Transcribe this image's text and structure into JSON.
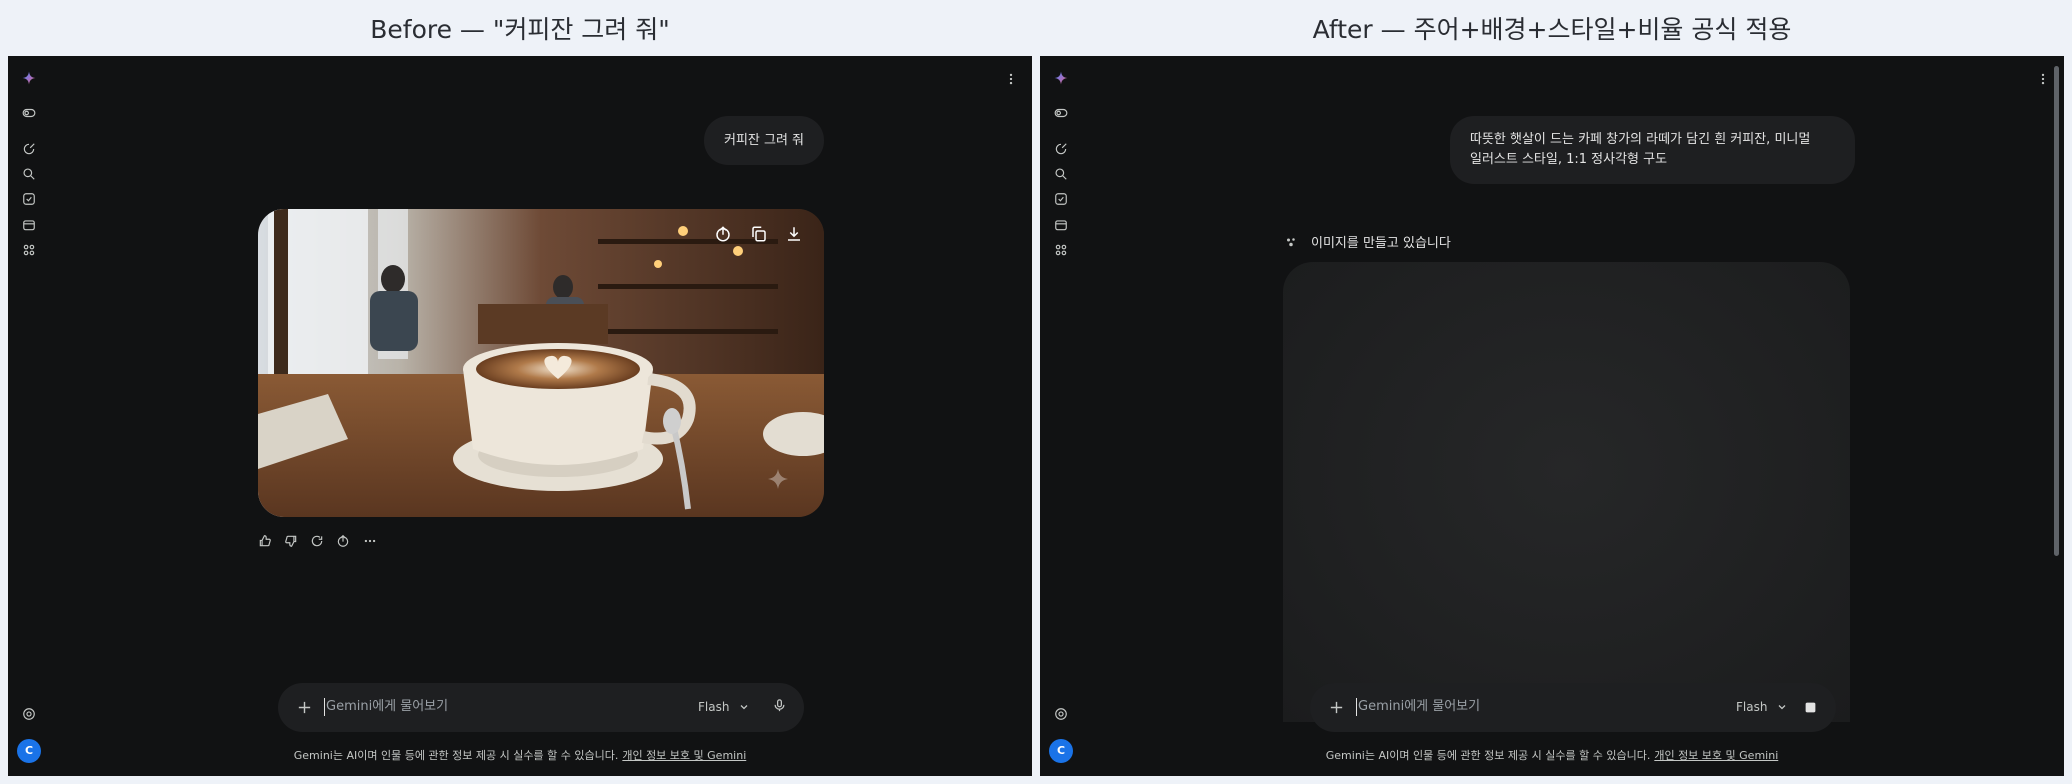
{
  "before": {
    "heading": "Before — \"커피잔 그려 줘\"",
    "user_prompt": "커피잔 그려 줘",
    "composer": {
      "placeholder": "Gemini에게 물어보기",
      "model": "Flash"
    },
    "disclaimer": {
      "text": "Gemini는 AI이며 인물 등에 관한 정보 제공 시 실수를 할 수 있습니다.",
      "link": "개인 정보 보호 및 Gemini"
    },
    "avatar_initial": "C"
  },
  "after": {
    "heading": "After — 주어+배경+스타일+비율 공식 적용",
    "user_prompt_line1": "따뜻한 햇살이 드는 카페 창가의 라떼가 담긴 흰 커피잔, 미니멀",
    "user_prompt_line2": "일러스트 스타일, 1:1 정사각형 구도",
    "status": "이미지를 만들고 있습니다",
    "composer": {
      "placeholder": "Gemini에게 물어보기",
      "model": "Flash"
    },
    "disclaimer": {
      "text": "Gemini는 AI이며 인물 등에 관한 정보 제공 시 실수를 할 수 있습니다.",
      "link": "개인 정보 보호 및 Gemini"
    },
    "avatar_initial": "C"
  },
  "colors": {
    "page_bg": "#eef2f8",
    "window_bg": "#111213",
    "surface": "#1e1f21",
    "text": "#e3e3e3",
    "muted": "#9aa0a6",
    "avatar": "#1a73e8"
  },
  "icons": {
    "rail": [
      "gemini-spark-icon",
      "sidebar-toggle-icon",
      "new-chat-icon",
      "search-icon",
      "gems-icon",
      "library-icon",
      "apps-icon",
      "settings-icon"
    ],
    "image_actions": [
      "share-icon",
      "copy-icon",
      "download-icon"
    ],
    "reactions": [
      "thumbs-up-icon",
      "thumbs-down-icon",
      "regenerate-icon",
      "share-icon",
      "more-icon"
    ],
    "composer": [
      "plus-icon",
      "chevron-down-icon",
      "mic-icon",
      "stop-icon"
    ]
  }
}
